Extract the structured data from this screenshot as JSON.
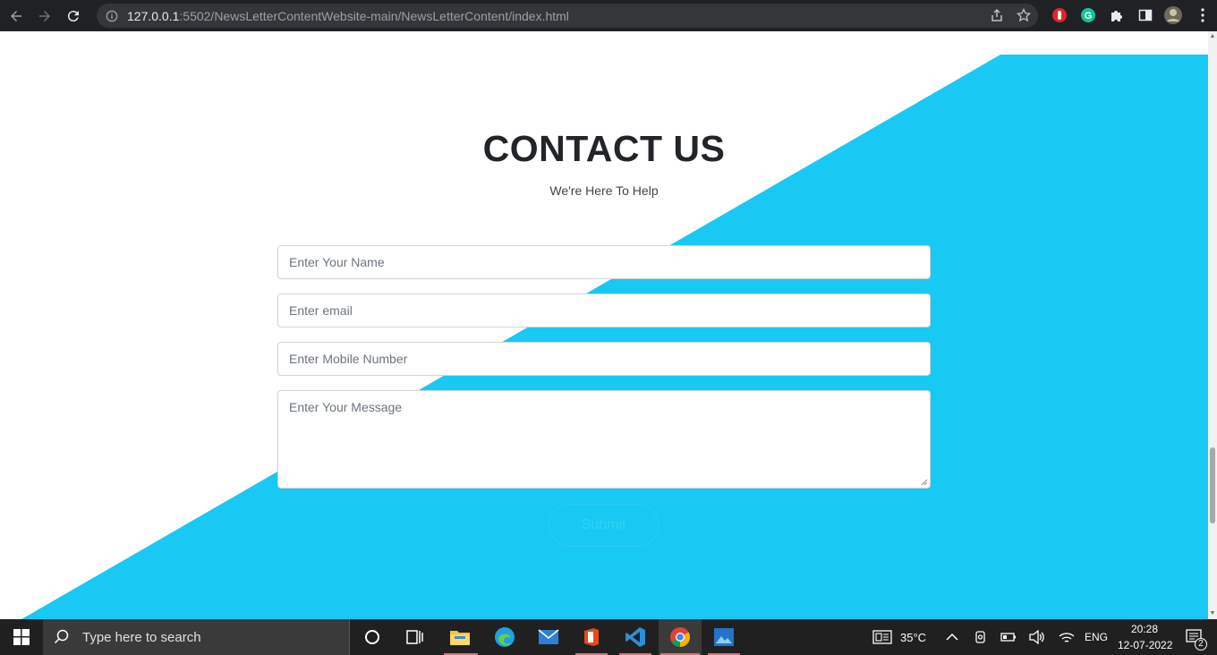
{
  "browser": {
    "url_host": "127.0.0.1",
    "url_rest": ":5502/NewsLetterContentWebsite-main/NewsLetterContent/index.html"
  },
  "contact": {
    "title": "CONTACT US",
    "subtitle": "We're Here To Help",
    "name_placeholder": "Enter Your Name",
    "email_placeholder": "Enter email",
    "mobile_placeholder": "Enter Mobile Number",
    "message_placeholder": "Enter Your Message",
    "submit_label": "Submit"
  },
  "colors": {
    "accent": "#18c9f4",
    "title": "#212529"
  },
  "taskbar": {
    "search_placeholder": "Type here to search",
    "weather": "35°C",
    "language": "ENG",
    "time": "20:28",
    "date": "12-07-2022",
    "notification_count": "2",
    "app_icons": [
      "cortana-icon",
      "task-view-icon",
      "file-explorer-icon",
      "edge-icon",
      "mail-icon",
      "office-icon",
      "vscode-icon",
      "chrome-icon",
      "photos-icon"
    ]
  }
}
